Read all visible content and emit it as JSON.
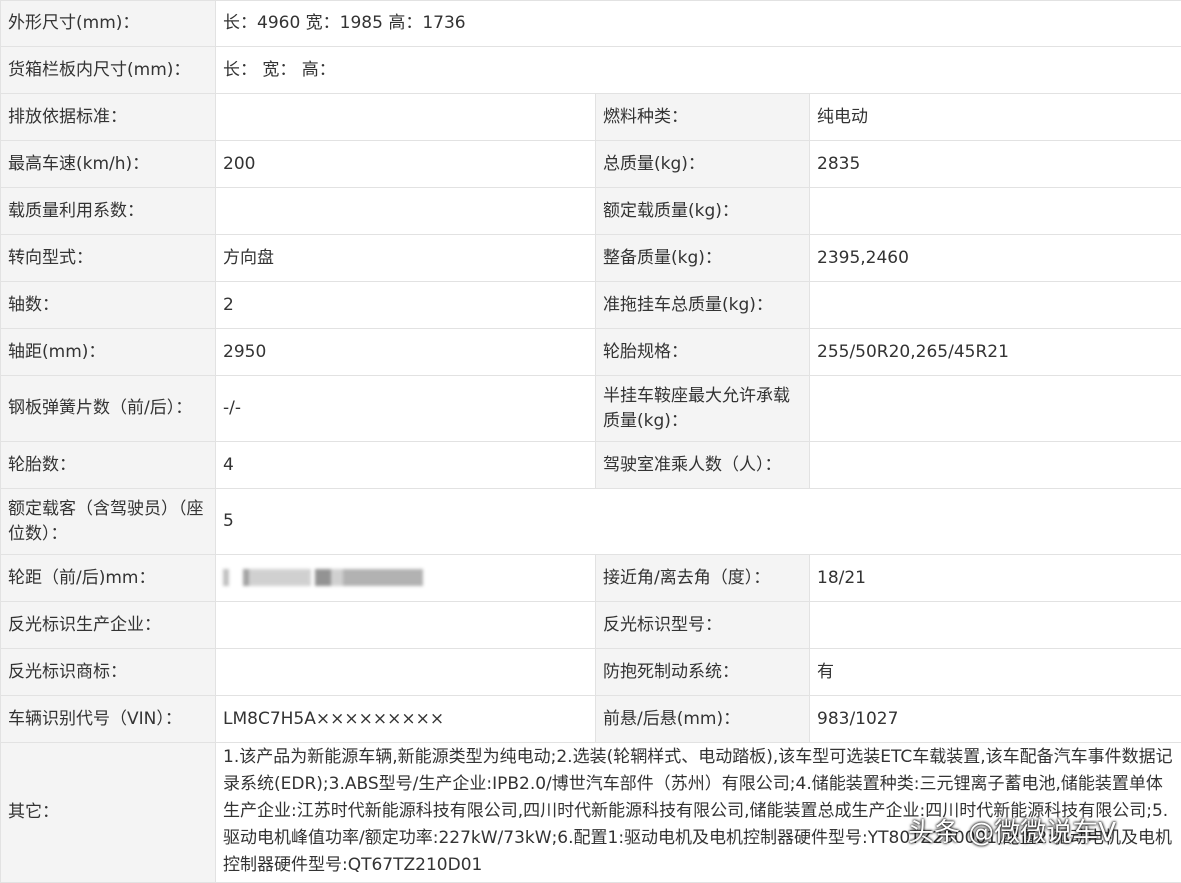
{
  "rows": {
    "dimensions": {
      "label": "外形尺寸(mm)：",
      "value": "长：4960 宽：1985 高：1736"
    },
    "cargo_box": {
      "label": "货箱栏板内尺寸(mm)：",
      "value": "长： 宽： 高："
    },
    "emission": {
      "label": "排放依据标准：",
      "value": "",
      "label2": "燃料种类：",
      "value2": "纯电动"
    },
    "speed": {
      "label": "最高车速(km/h)：",
      "value": "200",
      "label2": "总质量(kg)：",
      "value2": "2835"
    },
    "load_factor": {
      "label": "载质量利用系数：",
      "value": "",
      "label2": "额定载质量(kg)：",
      "value2": ""
    },
    "steering": {
      "label": "转向型式：",
      "value": "方向盘",
      "label2": "整备质量(kg)：",
      "value2": "2395,2460"
    },
    "axles": {
      "label": "轴数：",
      "value": "2",
      "label2": "准拖挂车总质量(kg)：",
      "value2": ""
    },
    "wheelbase": {
      "label": "轴距(mm)：",
      "value": "2950",
      "label2": "轮胎规格：",
      "value2": "255/50R20,265/45R21"
    },
    "springs": {
      "label": "钢板弹簧片数（前/后）：",
      "value": "-/-",
      "label2": "半挂车鞍座最大允许承载质量(kg)：",
      "value2": ""
    },
    "tires": {
      "label": "轮胎数：",
      "value": "4",
      "label2": "驾驶室准乘人数（人）：",
      "value2": ""
    },
    "passengers": {
      "label": "额定载客（含驾驶员）（座位数）：",
      "value": "5"
    },
    "track": {
      "label": "轮距（前/后)mm：",
      "value": "",
      "label2": "接近角/离去角（度）：",
      "value2": "18/21"
    },
    "reflector_maker": {
      "label": "反光标识生产企业：",
      "value": "",
      "label2": "反光标识型号：",
      "value2": ""
    },
    "reflector_brand": {
      "label": "反光标识商标：",
      "value": "",
      "label2": "防抱死制动系统：",
      "value2": "有"
    },
    "vin": {
      "label": "车辆识别代号（VIN）：",
      "value": "LM8C7H5A×××××××××",
      "label2": "前悬/后悬(mm)：",
      "value2": "983/1027"
    },
    "other": {
      "label": "其它：",
      "value": "1.该产品为新能源车辆,新能源类型为纯电动;2.选装(轮辋样式、电动踏板),该车型可选装ETC车载装置,该车配备汽车事件数据记录系统(EDR);3.ABS型号/生产企业:IPB2.0/博世汽车部件（苏州）有限公司;4.储能装置种类:三元锂离子蓄电池,储能装置单体生产企业:江苏时代新能源科技有限公司,四川时代新能源科技有限公司,储能装置总成生产企业:四川时代新能源科技有限公司;5.驱动电机峰值功率/额定功率:227kW/73kW;6.配置1:驱动电机及电机控制器硬件型号:YT80TZ230001,配置2:驱动电机及电机控制器硬件型号:QT67TZ210D01"
    }
  },
  "watermark": "头条 @微微说车V"
}
